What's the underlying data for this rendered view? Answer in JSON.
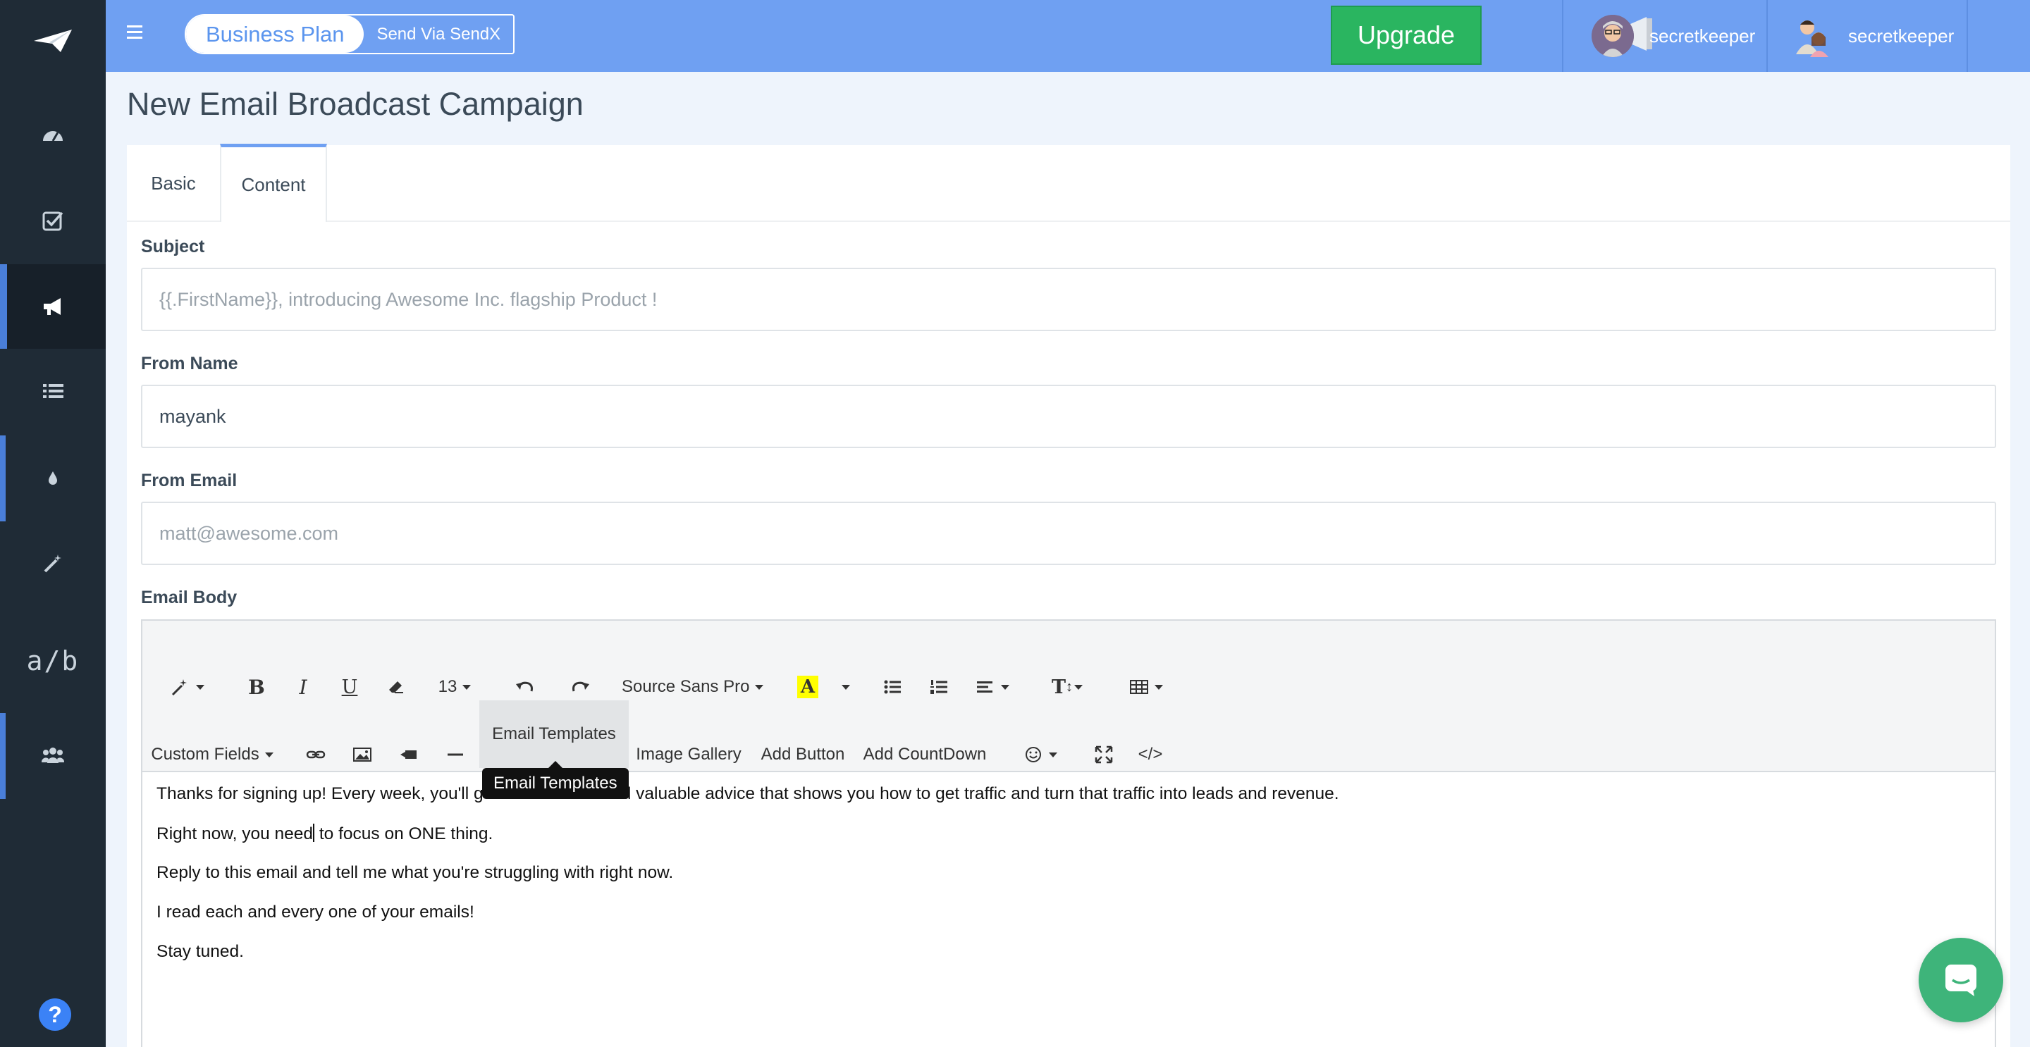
{
  "topbar": {
    "plan_label": "Business Plan",
    "send_label": "Send Via SendX",
    "upgrade_label": "Upgrade",
    "user1": "secretkeeper",
    "user2": "secretkeeper"
  },
  "sidebar": {
    "items": [
      "logo-icon",
      "dashboard-icon",
      "checklist-icon",
      "campaign-megaphone-icon",
      "lists-icon",
      "drip-icon",
      "magic-wand-icon",
      "ab-test",
      "team-icon"
    ],
    "ab_label": "a/b",
    "help_label": "?"
  },
  "page": {
    "title": "New Email Broadcast Campaign",
    "tabs": [
      "Basic",
      "Content"
    ]
  },
  "form": {
    "subject_label": "Subject",
    "subject_placeholder": "{{.FirstName}}, introducing Awesome Inc. flagship Product !",
    "from_name_label": "From Name",
    "from_name_value": "mayank",
    "from_email_label": "From Email",
    "from_email_placeholder": "matt@awesome.com",
    "body_label": "Email Body"
  },
  "editor": {
    "font_size": "13",
    "font_family": "Source Sans Pro",
    "custom_fields": "Custom Fields",
    "email_templates": "Email Templates",
    "image_gallery": "Image Gallery",
    "add_button": "Add Button",
    "add_countdown": "Add CountDown",
    "code_label": "</>",
    "tooltip": "Email Templates",
    "paragraphs": [
      "Thanks for signing up! Every week, you'll get battle-tested and valuable advice that shows you how to get traffic and turn that traffic into leads and revenue.",
      "Right now, you need to focus on ONE thing.",
      "Reply to this email and tell me what you're struggling with right now.",
      "I read each and every one of your emails!",
      "Stay tuned."
    ],
    "para2_before_cursor": "Right now, you need",
    "para2_after_cursor": " to focus on ONE thing."
  },
  "colors": {
    "topbar": "#6fa0f2",
    "sidebar": "#1f2b36",
    "upgrade": "#2ab560",
    "accent": "#4a7fd9",
    "chat": "#3eb47a"
  }
}
